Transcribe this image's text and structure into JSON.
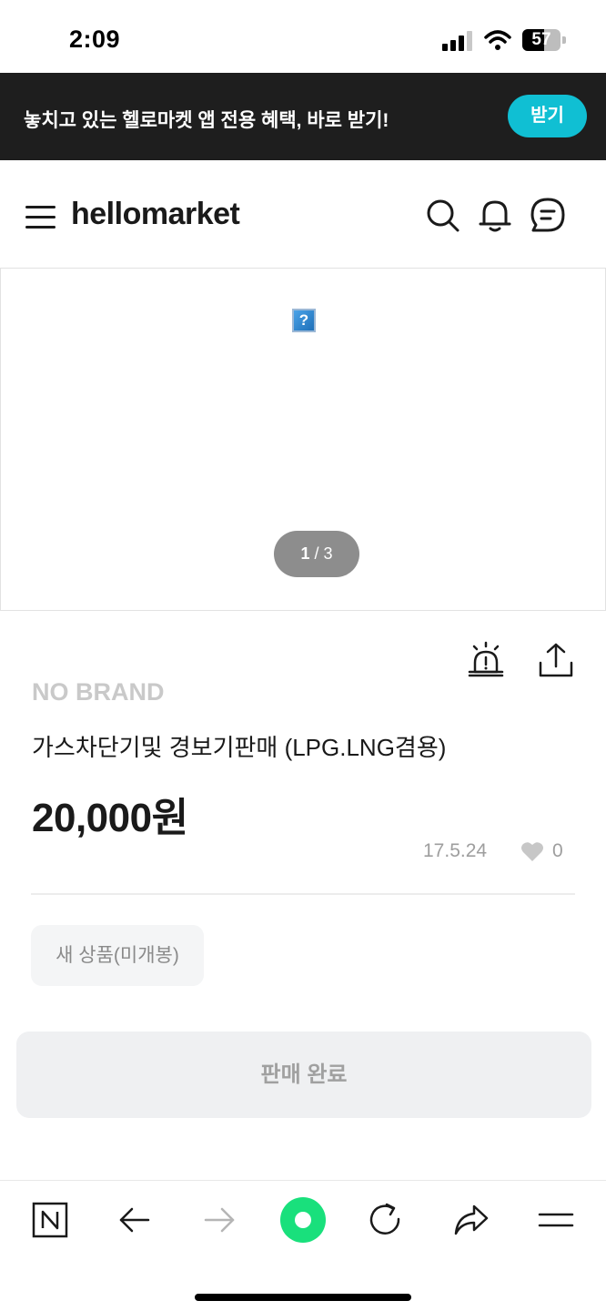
{
  "status_bar": {
    "time": "2:09",
    "battery": "57",
    "battery_level": 0.57
  },
  "promo": {
    "text": "놓치고 있는 헬로마켓 앱 전용 혜택, 바로 받기!",
    "button_label": "받기",
    "button_color": "#10bfd3"
  },
  "header": {
    "logo": "hellomarket",
    "icons": [
      "menu-icon",
      "search-icon",
      "bell-icon",
      "chat-icon"
    ]
  },
  "gallery": {
    "current": "1",
    "separator": " / ",
    "total": "3"
  },
  "product": {
    "actions": [
      "siren-icon",
      "share-icon"
    ],
    "brand": "NO BRAND",
    "title": "가스차단기및 경보기판매 (LPG.LNG겸용)",
    "price": "20,000원",
    "date": "17.5.24",
    "likes": "0",
    "condition_tag": "새 상품(미개봉)",
    "status_button": "판매 완료"
  },
  "browser_bar": {
    "icons": [
      "naver-icon",
      "back-arrow-icon",
      "forward-arrow-icon",
      "green-dot-icon",
      "reload-icon",
      "share-arrow-icon",
      "hamburger-icon"
    ],
    "accent": "#19e07c"
  }
}
